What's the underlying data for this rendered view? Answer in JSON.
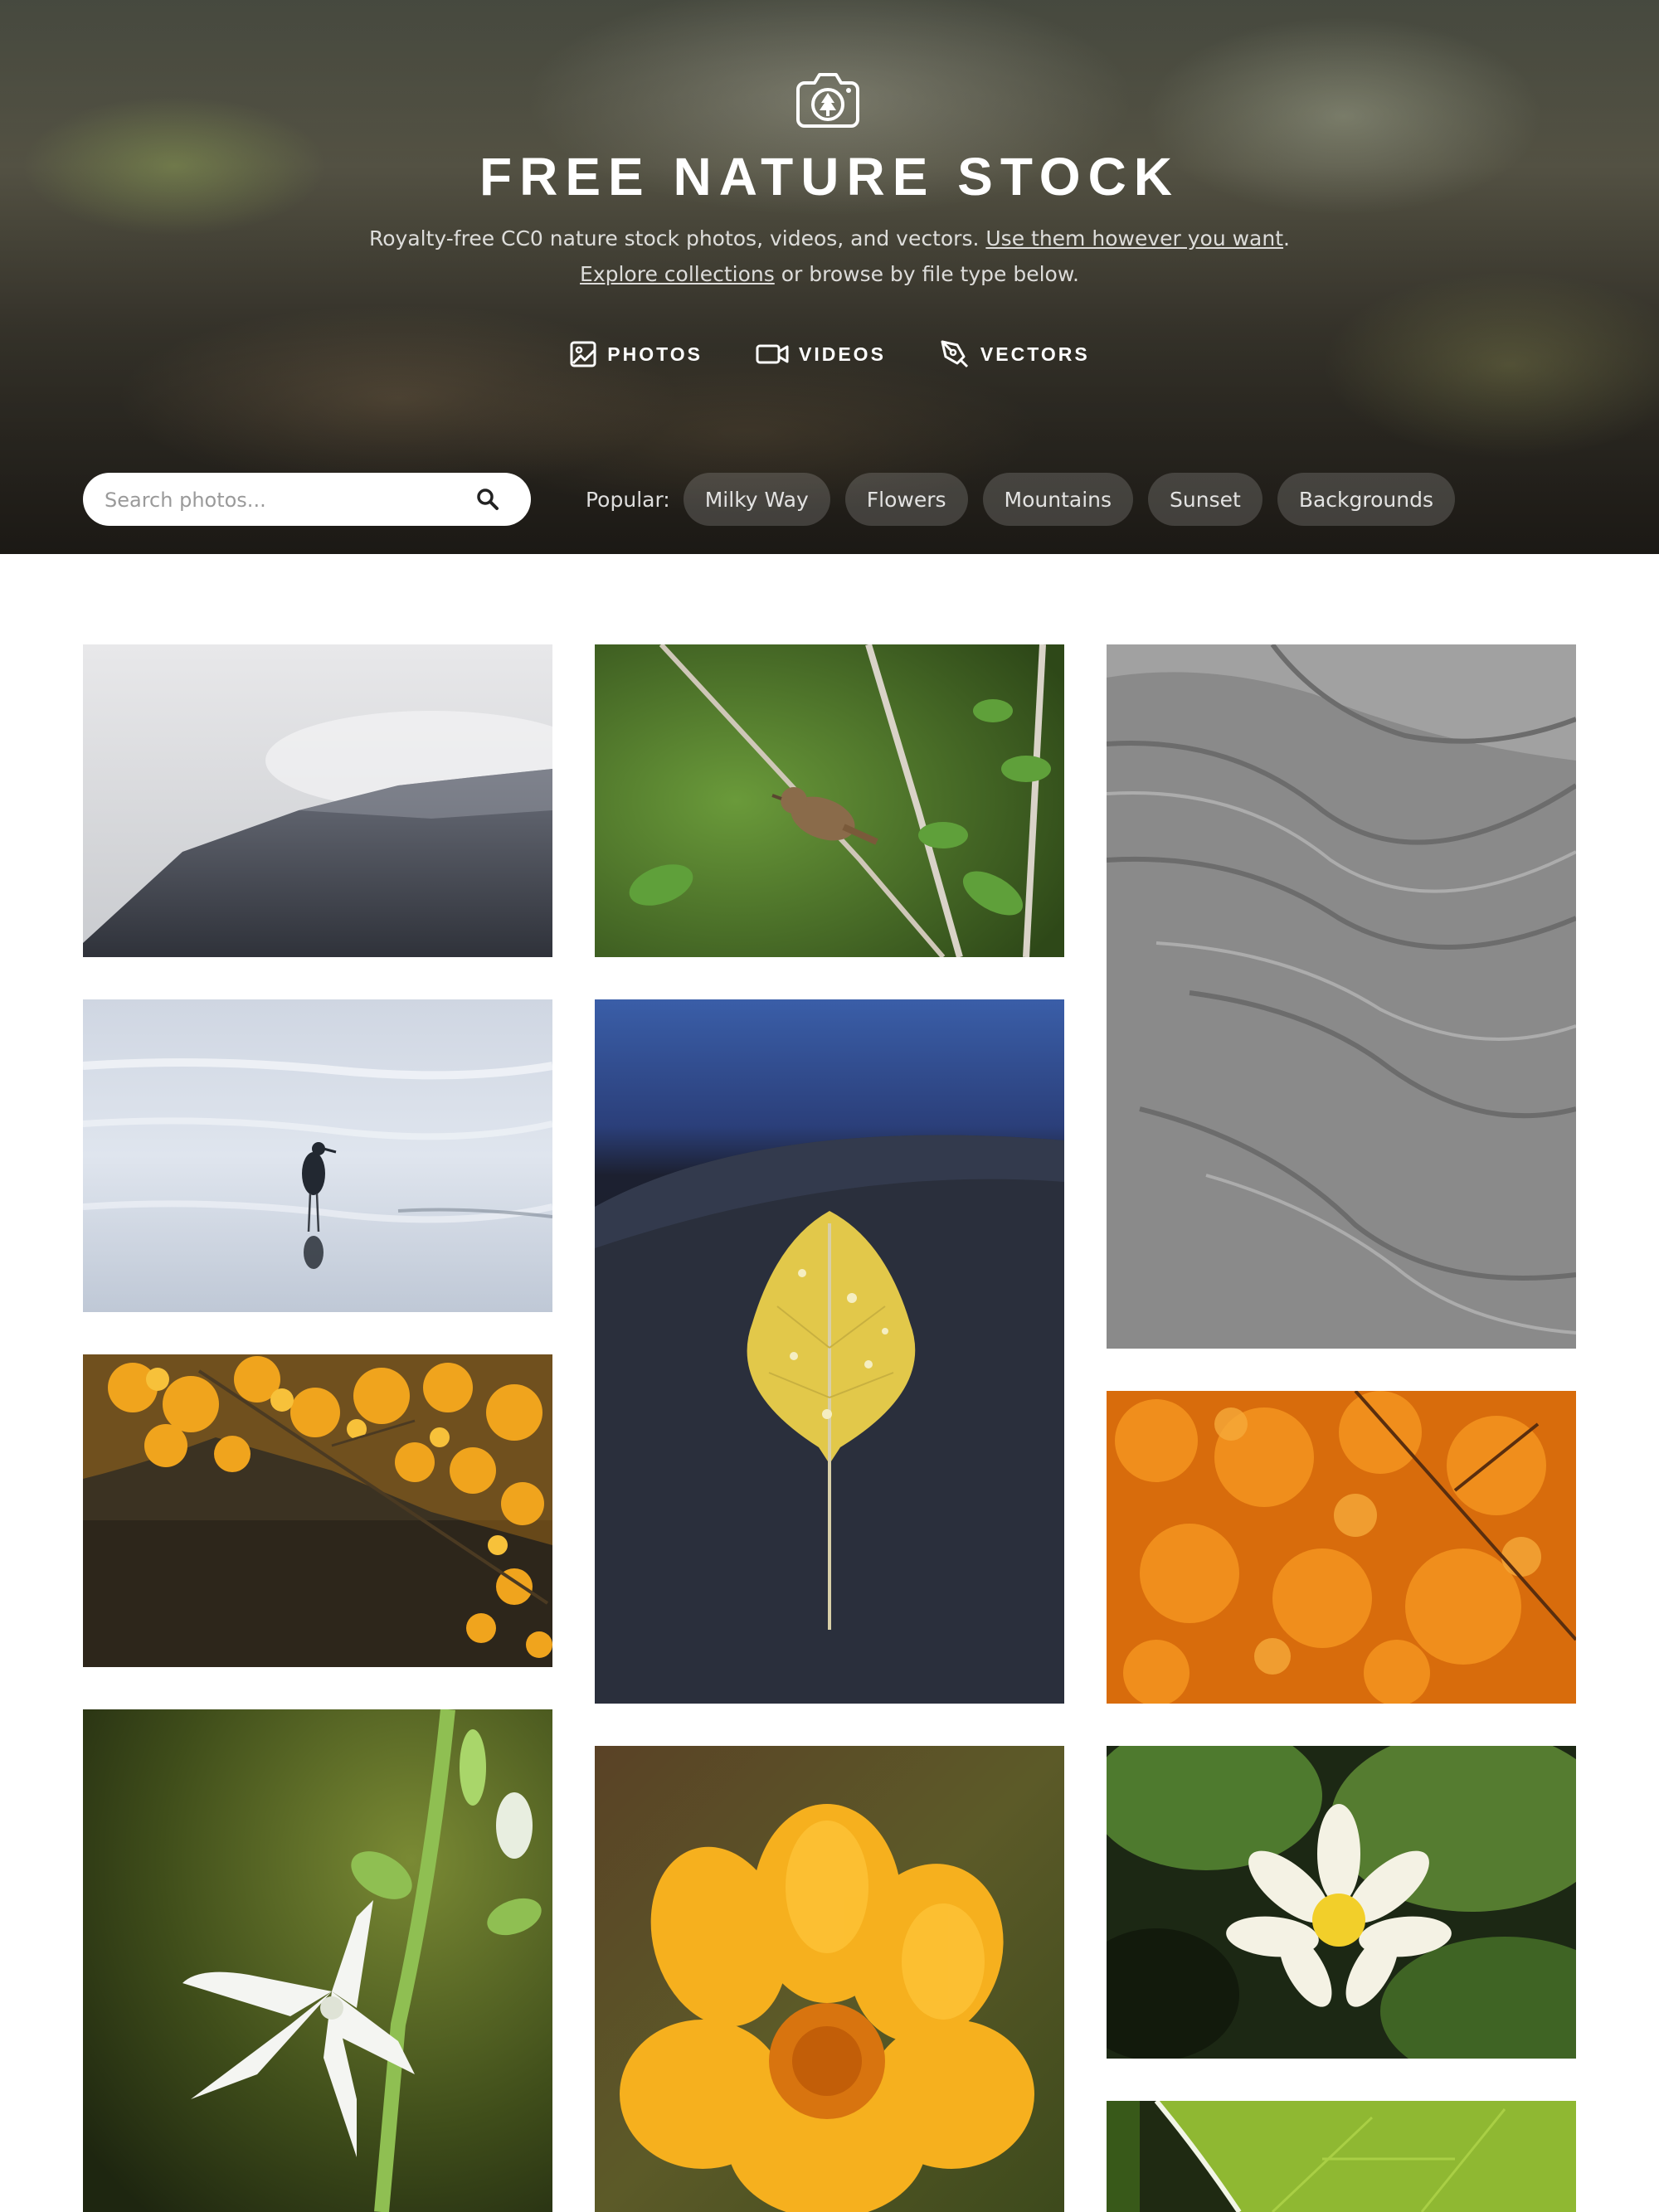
{
  "header": {
    "logo_icon": "camera-tree-icon",
    "title": "FREE NATURE STOCK",
    "tagline_text": "Royalty-free CC0 nature stock photos, videos, and vectors. ",
    "tagline_link": "Use them however you want",
    "tagline_end": ".",
    "browse_link": "Explore collections",
    "browse_text": " or browse by file type below.",
    "file_types": [
      {
        "label": "PHOTOS",
        "icon": "image-icon"
      },
      {
        "label": "VIDEOS",
        "icon": "video-camera-icon"
      },
      {
        "label": "VECTORS",
        "icon": "pen-tool-icon"
      }
    ]
  },
  "search": {
    "placeholder": "Search photos...",
    "icon": "search-icon"
  },
  "popular": {
    "label": "Popular:",
    "tags": [
      "Milky Way",
      "Flowers",
      "Mountains",
      "Sunset",
      "Backgrounds"
    ]
  },
  "gallery": {
    "photos": [
      "misty-mountain",
      "wren-on-branch",
      "gray-rock-texture",
      "wading-bird",
      "yellow-aspen-leaf",
      "orange-maple-tree",
      "autumn-orange-leaves",
      "white-hosta-flower",
      "orange-marigold",
      "white-water-lily",
      "green-leaf"
    ]
  }
}
